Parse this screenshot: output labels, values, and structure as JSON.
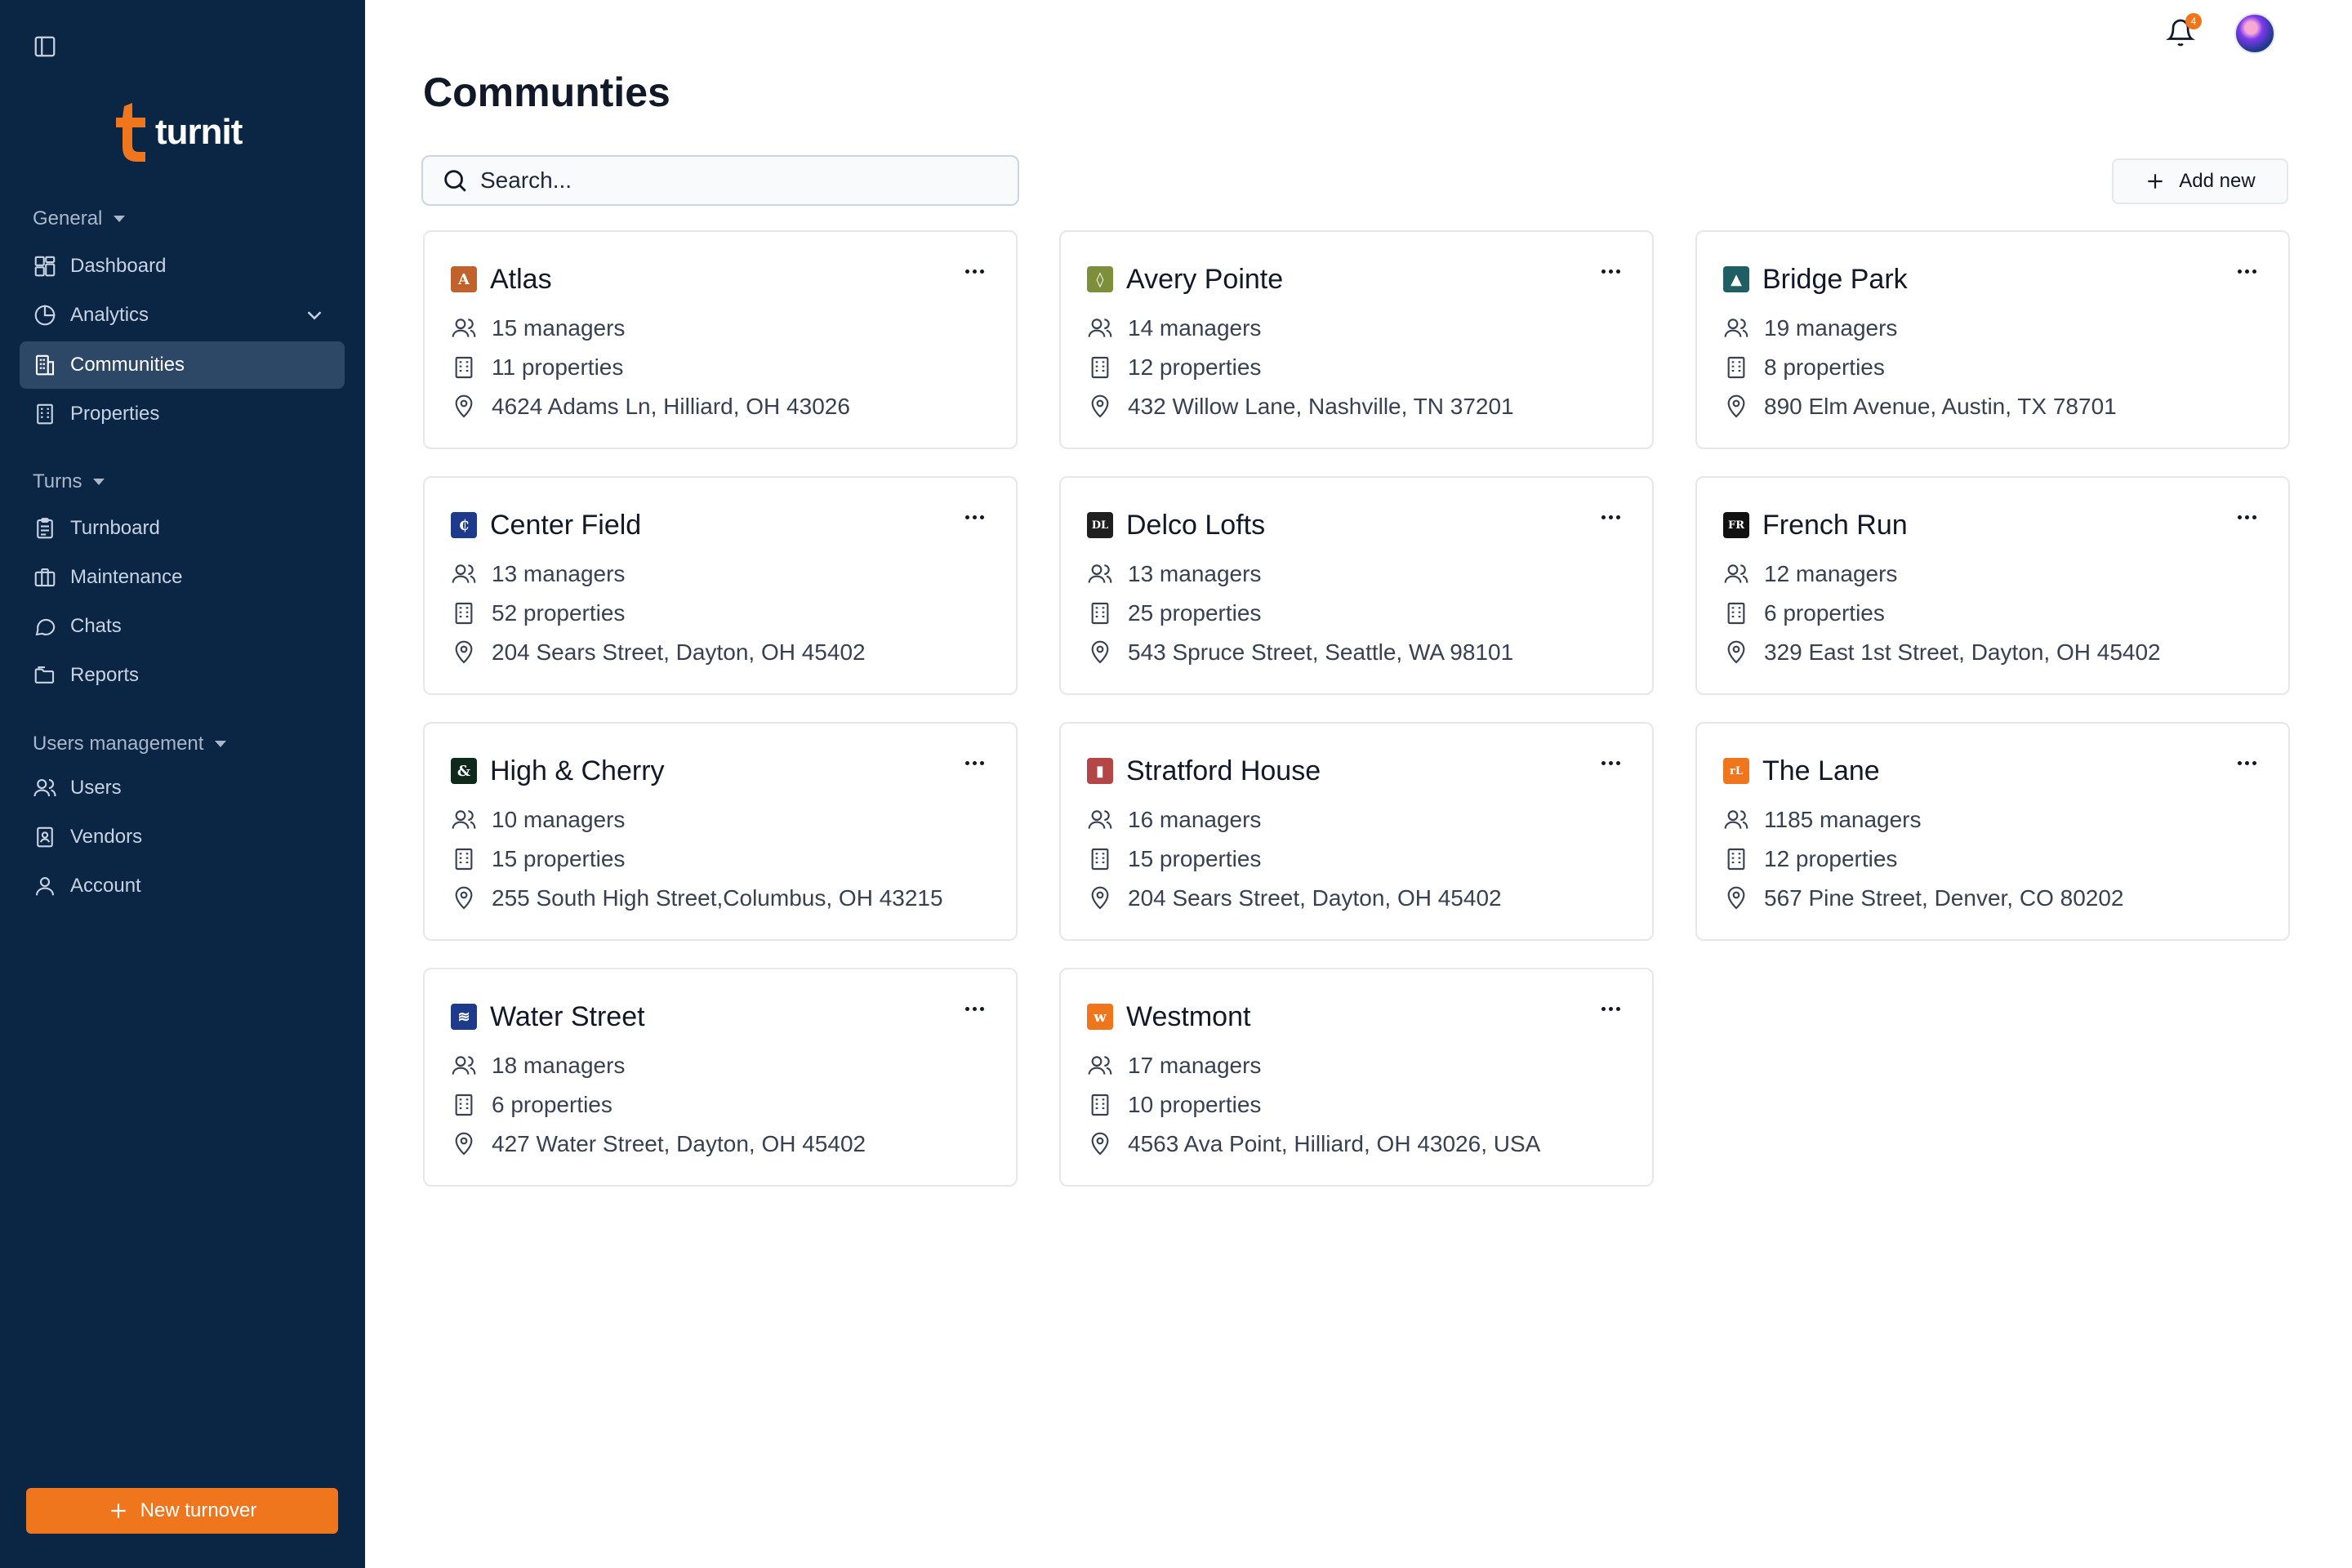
{
  "brand": {
    "name": "turnit",
    "accent": "#f0761e",
    "sidebar_bg": "#0b2545"
  },
  "sidebar": {
    "sections": [
      {
        "label": "General"
      },
      {
        "label": "Turns"
      },
      {
        "label": "Users management"
      }
    ],
    "items": [
      {
        "label": "Dashboard",
        "icon": "dashboard-icon"
      },
      {
        "label": "Analytics",
        "icon": "pie-chart-icon"
      },
      {
        "label": "Communities",
        "icon": "building-icon",
        "active": true
      },
      {
        "label": "Properties",
        "icon": "building-icon"
      },
      {
        "label": "Turnboard",
        "icon": "clipboard-icon"
      },
      {
        "label": "Maintenance",
        "icon": "toolbox-icon"
      },
      {
        "label": "Chats",
        "icon": "chat-icon"
      },
      {
        "label": "Reports",
        "icon": "folder-icon"
      },
      {
        "label": "Users",
        "icon": "users-icon"
      },
      {
        "label": "Vendors",
        "icon": "vendor-icon"
      },
      {
        "label": "Account",
        "icon": "user-icon"
      }
    ],
    "new_turnover_label": "New turnover"
  },
  "header": {
    "notification_count": "4"
  },
  "main": {
    "title": "Communties",
    "search_placeholder": "Search...",
    "add_new_label": "Add new"
  },
  "communities": [
    {
      "name": "Atlas",
      "managers": "15 managers",
      "properties": "11 properties",
      "address": "4624 Adams Ln, Hilliard, OH 43026",
      "logo_text": "A",
      "logo_color": "#c0622b"
    },
    {
      "name": "Avery Pointe",
      "managers": "14 managers",
      "properties": "12 properties",
      "address": "432 Willow Lane, Nashville, TN 37201",
      "logo_text": "◊",
      "logo_color": "#7d8f3a"
    },
    {
      "name": "Bridge Park",
      "managers": "19 managers",
      "properties": "8 properties",
      "address": "890 Elm Avenue, Austin, TX 78701",
      "logo_text": "▲",
      "logo_color": "#1f5e63"
    },
    {
      "name": "Center Field",
      "managers": "13 managers",
      "properties": "52 properties",
      "address": "204 Sears Street, Dayton, OH 45402",
      "logo_text": "₵",
      "logo_color": "#1e3a8a"
    },
    {
      "name": "Delco Lofts",
      "managers": "13 managers",
      "properties": "25 properties",
      "address": "543 Spruce Street, Seattle, WA 98101",
      "logo_text": "DL",
      "logo_color": "#1f1f1f"
    },
    {
      "name": "French Run",
      "managers": "12 managers",
      "properties": "6 properties",
      "address": "329 East 1st Street, Dayton, OH 45402",
      "logo_text": "FR",
      "logo_color": "#111111"
    },
    {
      "name": "High & Cherry",
      "managers": "10 managers",
      "properties": "15 properties",
      "address": "255 South High Street,Columbus, OH 43215",
      "logo_text": "&",
      "logo_color": "#0f2a1c"
    },
    {
      "name": "Stratford House",
      "managers": "16 managers",
      "properties": "15 properties",
      "address": "204 Sears Street, Dayton, OH 45402",
      "logo_text": "▮",
      "logo_color": "#b34747"
    },
    {
      "name": "The Lane",
      "managers": "1185 managers",
      "properties": "12 properties",
      "address": "567 Pine Street, Denver, CO 80202",
      "logo_text": "rL",
      "logo_color": "#f0761e"
    },
    {
      "name": "Water Street",
      "managers": "18 managers",
      "properties": "6 properties",
      "address": "427 Water Street, Dayton, OH 45402",
      "logo_text": "≋",
      "logo_color": "#1e3a8a"
    },
    {
      "name": "Westmont",
      "managers": "17 managers",
      "properties": "10 properties",
      "address": "4563 Ava Point, Hilliard, OH 43026, USA",
      "logo_text": "w",
      "logo_color": "#f0761e"
    }
  ]
}
